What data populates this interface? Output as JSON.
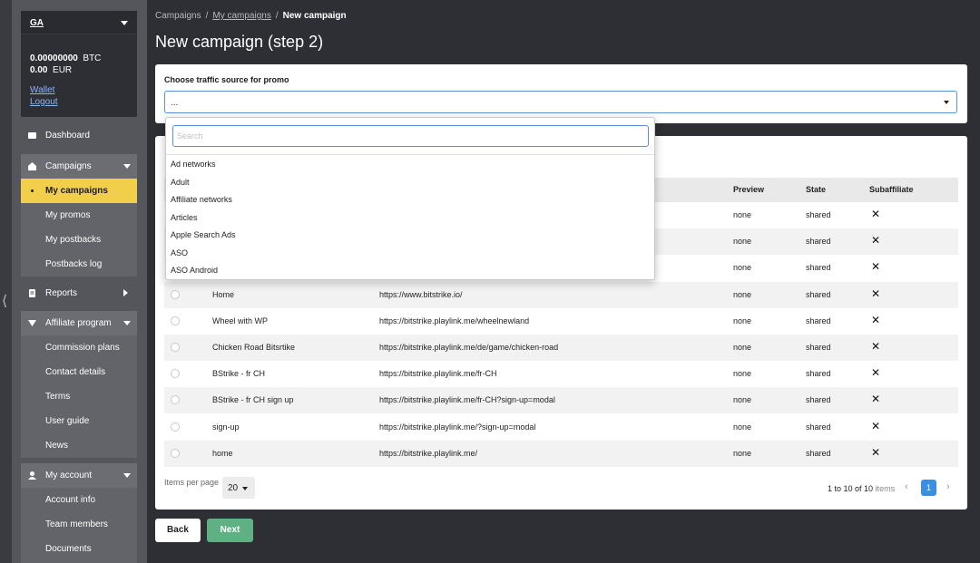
{
  "account": {
    "name": "GA",
    "btc_amount": "0.00000000",
    "btc_unit": "BTC",
    "eur_amount": "0.00",
    "eur_unit": "EUR",
    "wallet_link": "Wallet",
    "logout_link": "Logout"
  },
  "sidebar": {
    "dashboard": "Dashboard",
    "campaigns": {
      "label": "Campaigns",
      "items": [
        "My campaigns",
        "My promos",
        "My postbacks",
        "Postbacks log"
      ]
    },
    "reports": "Reports",
    "affiliate_program": {
      "label": "Affiliate program",
      "items": [
        "Commission plans",
        "Contact details",
        "Terms",
        "User guide",
        "News"
      ]
    },
    "my_account": {
      "label": "My account",
      "items": [
        "Account info",
        "Team members",
        "Documents"
      ]
    }
  },
  "breadcrumb": {
    "root": "Campaigns",
    "parent": "My campaigns",
    "current": "New campaign",
    "separator": "/"
  },
  "page_title": "New campaign (step 2)",
  "traffic_source": {
    "label": "Choose traffic source for promo",
    "value": "...",
    "search_placeholder": "Search",
    "options": [
      "Ad networks",
      "Adult",
      "Affiliate networks",
      "Articles",
      "Apple Search Ads",
      "ASO",
      "ASO Android"
    ]
  },
  "table": {
    "headers": {
      "preview": "Preview",
      "state": "State",
      "subaffiliate": "Subaffiliate"
    },
    "rows": [
      {
        "name": "",
        "url": "",
        "preview": "none",
        "state": "shared"
      },
      {
        "name": "",
        "url": "",
        "preview": "none",
        "state": "shared"
      },
      {
        "name": "",
        "url": "",
        "preview": "none",
        "state": "shared"
      },
      {
        "name": "Home",
        "url": "https://www.bitstrike.io/",
        "preview": "none",
        "state": "shared"
      },
      {
        "name": "Wheel with WP",
        "url": "https://bitstrike.playlink.me/wheelnewland",
        "preview": "none",
        "state": "shared"
      },
      {
        "name": "Chicken Road Bitsrtike",
        "url": "https://bitstrike.playlink.me/de/game/chicken-road",
        "preview": "none",
        "state": "shared"
      },
      {
        "name": "BStrike - fr CH",
        "url": "https://bitstrike.playlink.me/fr-CH",
        "preview": "none",
        "state": "shared"
      },
      {
        "name": "BStrike - fr CH sign up",
        "url": "https://bitstrike.playlink.me/fr-CH?sign-up=modal",
        "preview": "none",
        "state": "shared"
      },
      {
        "name": "sign-up",
        "url": "https://bitstrike.playlink.me/?sign-up=modal",
        "preview": "none",
        "state": "shared"
      },
      {
        "name": "home",
        "url": "https://bitstrike.playlink.me/",
        "preview": "none",
        "state": "shared"
      }
    ],
    "subaffiliate_mark": "✕"
  },
  "pagination": {
    "items_per_page_label": "Items per page",
    "items_per_page": "20",
    "range_text": "1 to 10 of 10",
    "items_word": "items",
    "current_page": "1"
  },
  "buttons": {
    "back": "Back",
    "next": "Next"
  },
  "colors": {
    "active_nav": "#f2cf4a",
    "next_button": "#5fb183",
    "page_active": "#3b8fe0",
    "focus_border": "#5b8fd8"
  }
}
